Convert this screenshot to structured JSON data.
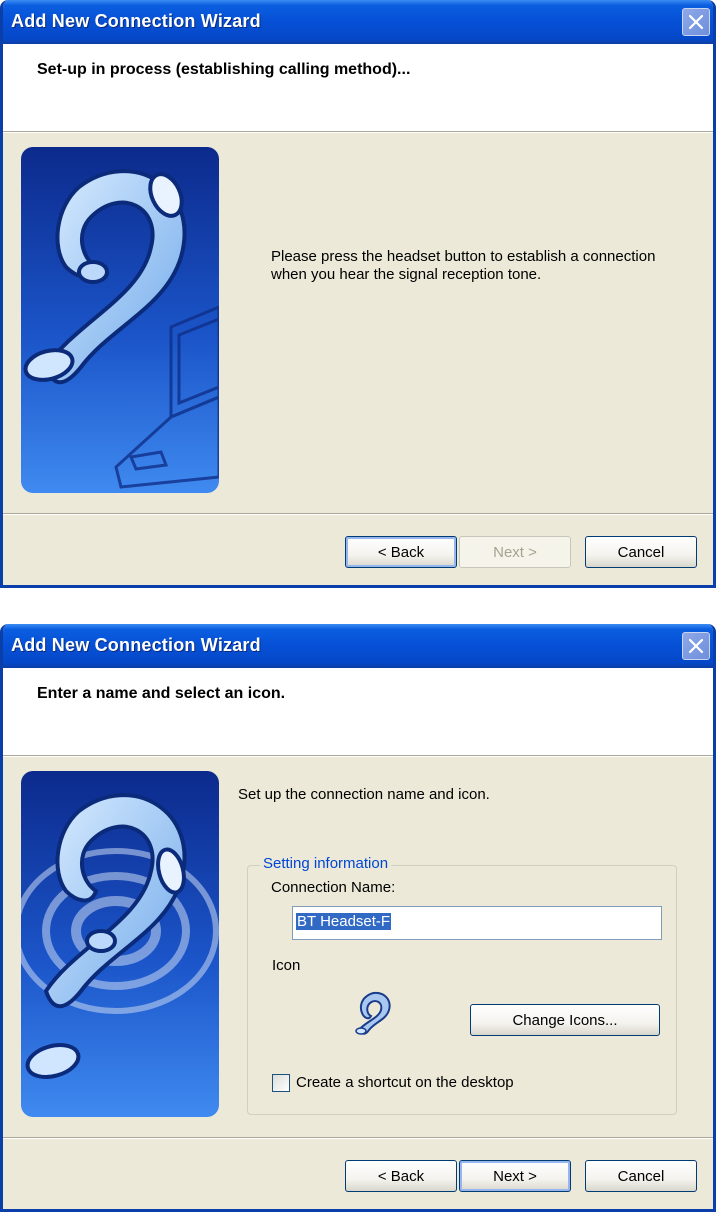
{
  "window1": {
    "title": "Add New Connection Wizard",
    "header": "Set-up in process (establishing calling method)...",
    "message_line1": "Please press the headset button to establish a connection",
    "message_line2": "when you hear the signal reception tone.",
    "buttons": {
      "back": "< Back",
      "next": "Next >",
      "cancel": "Cancel"
    },
    "icons": {
      "close": "close-icon",
      "side_image": "headset-laptop-illustration"
    }
  },
  "window2": {
    "title": "Add New Connection Wizard",
    "header": "Enter a name and select an icon.",
    "intro": "Set up the connection name and icon.",
    "group_title": "Setting information",
    "connection_name_label": "Connection Name:",
    "connection_name_value": "BT Headset-F",
    "icon_label": "Icon",
    "change_icons_button": "Change Icons...",
    "shortcut_checkbox_label": "Create a shortcut on the desktop",
    "shortcut_checked": false,
    "buttons": {
      "back": "< Back",
      "next": "Next >",
      "cancel": "Cancel"
    },
    "icons": {
      "close": "close-icon",
      "side_image": "headset-waves-illustration",
      "icon_preview": "headset-icon"
    }
  },
  "colors": {
    "titlebar": "#0650d6",
    "dialog_face": "#ece9d8",
    "group_title": "#0046d5",
    "selection": "#316ac5"
  }
}
